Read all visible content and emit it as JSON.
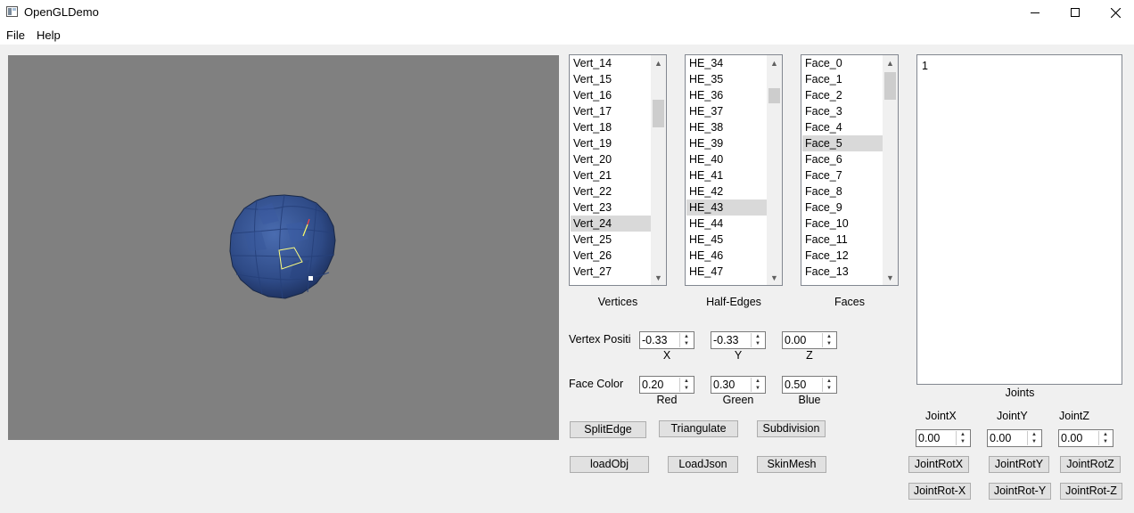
{
  "window": {
    "title": "OpenGLDemo",
    "minimize_icon": "minimize-icon",
    "maximize_icon": "maximize-icon",
    "close_icon": "close-icon"
  },
  "menu": {
    "items": [
      "File",
      "Help"
    ]
  },
  "vertices": {
    "label": "Vertices",
    "items": [
      "Vert_14",
      "Vert_15",
      "Vert_16",
      "Vert_17",
      "Vert_18",
      "Vert_19",
      "Vert_20",
      "Vert_21",
      "Vert_22",
      "Vert_23",
      "Vert_24",
      "Vert_25",
      "Vert_26",
      "Vert_27"
    ],
    "selected": "Vert_24"
  },
  "halfedges": {
    "label": "Half-Edges",
    "items": [
      "HE_34",
      "HE_35",
      "HE_36",
      "HE_37",
      "HE_38",
      "HE_39",
      "HE_40",
      "HE_41",
      "HE_42",
      "HE_43",
      "HE_44",
      "HE_45",
      "HE_46",
      "HE_47"
    ],
    "selected": "HE_43"
  },
  "faces": {
    "label": "Faces",
    "items": [
      "Face_0",
      "Face_1",
      "Face_2",
      "Face_3",
      "Face_4",
      "Face_5",
      "Face_6",
      "Face_7",
      "Face_8",
      "Face_9",
      "Face_10",
      "Face_11",
      "Face_12",
      "Face_13"
    ],
    "selected": "Face_5"
  },
  "vertex_position": {
    "label": "Vertex Positi",
    "x": "-0.33",
    "y": "-0.33",
    "z": "0.00",
    "x_label": "X",
    "y_label": "Y",
    "z_label": "Z"
  },
  "face_color": {
    "label": "Face Color",
    "red": "0.20",
    "green": "0.30",
    "blue": "0.50",
    "red_label": "Red",
    "green_label": "Green",
    "blue_label": "Blue"
  },
  "buttons": {
    "split_edge": "SplitEdge",
    "triangulate": "Triangulate",
    "subdivision": "Subdivision",
    "load_obj": "loadObj",
    "load_json": "LoadJson",
    "skin_mesh": "SkinMesh"
  },
  "joints": {
    "tree_item": "1",
    "label": "Joints",
    "x_label": "JointX",
    "y_label": "JointY",
    "z_label": "JointZ",
    "x": "0.00",
    "y": "0.00",
    "z": "0.00",
    "rot_x": "JointRotX",
    "rot_y": "JointRotY",
    "rot_z": "JointRotZ",
    "rot_neg_x": "JointRot-X",
    "rot_neg_y": "JointRot-Y",
    "rot_neg_z": "JointRot-Z"
  },
  "colors": {
    "viewport": "#808080",
    "sphere": "#2e4a86",
    "highlight_face": "#ffff80",
    "highlight_edge": "#ff4040"
  }
}
